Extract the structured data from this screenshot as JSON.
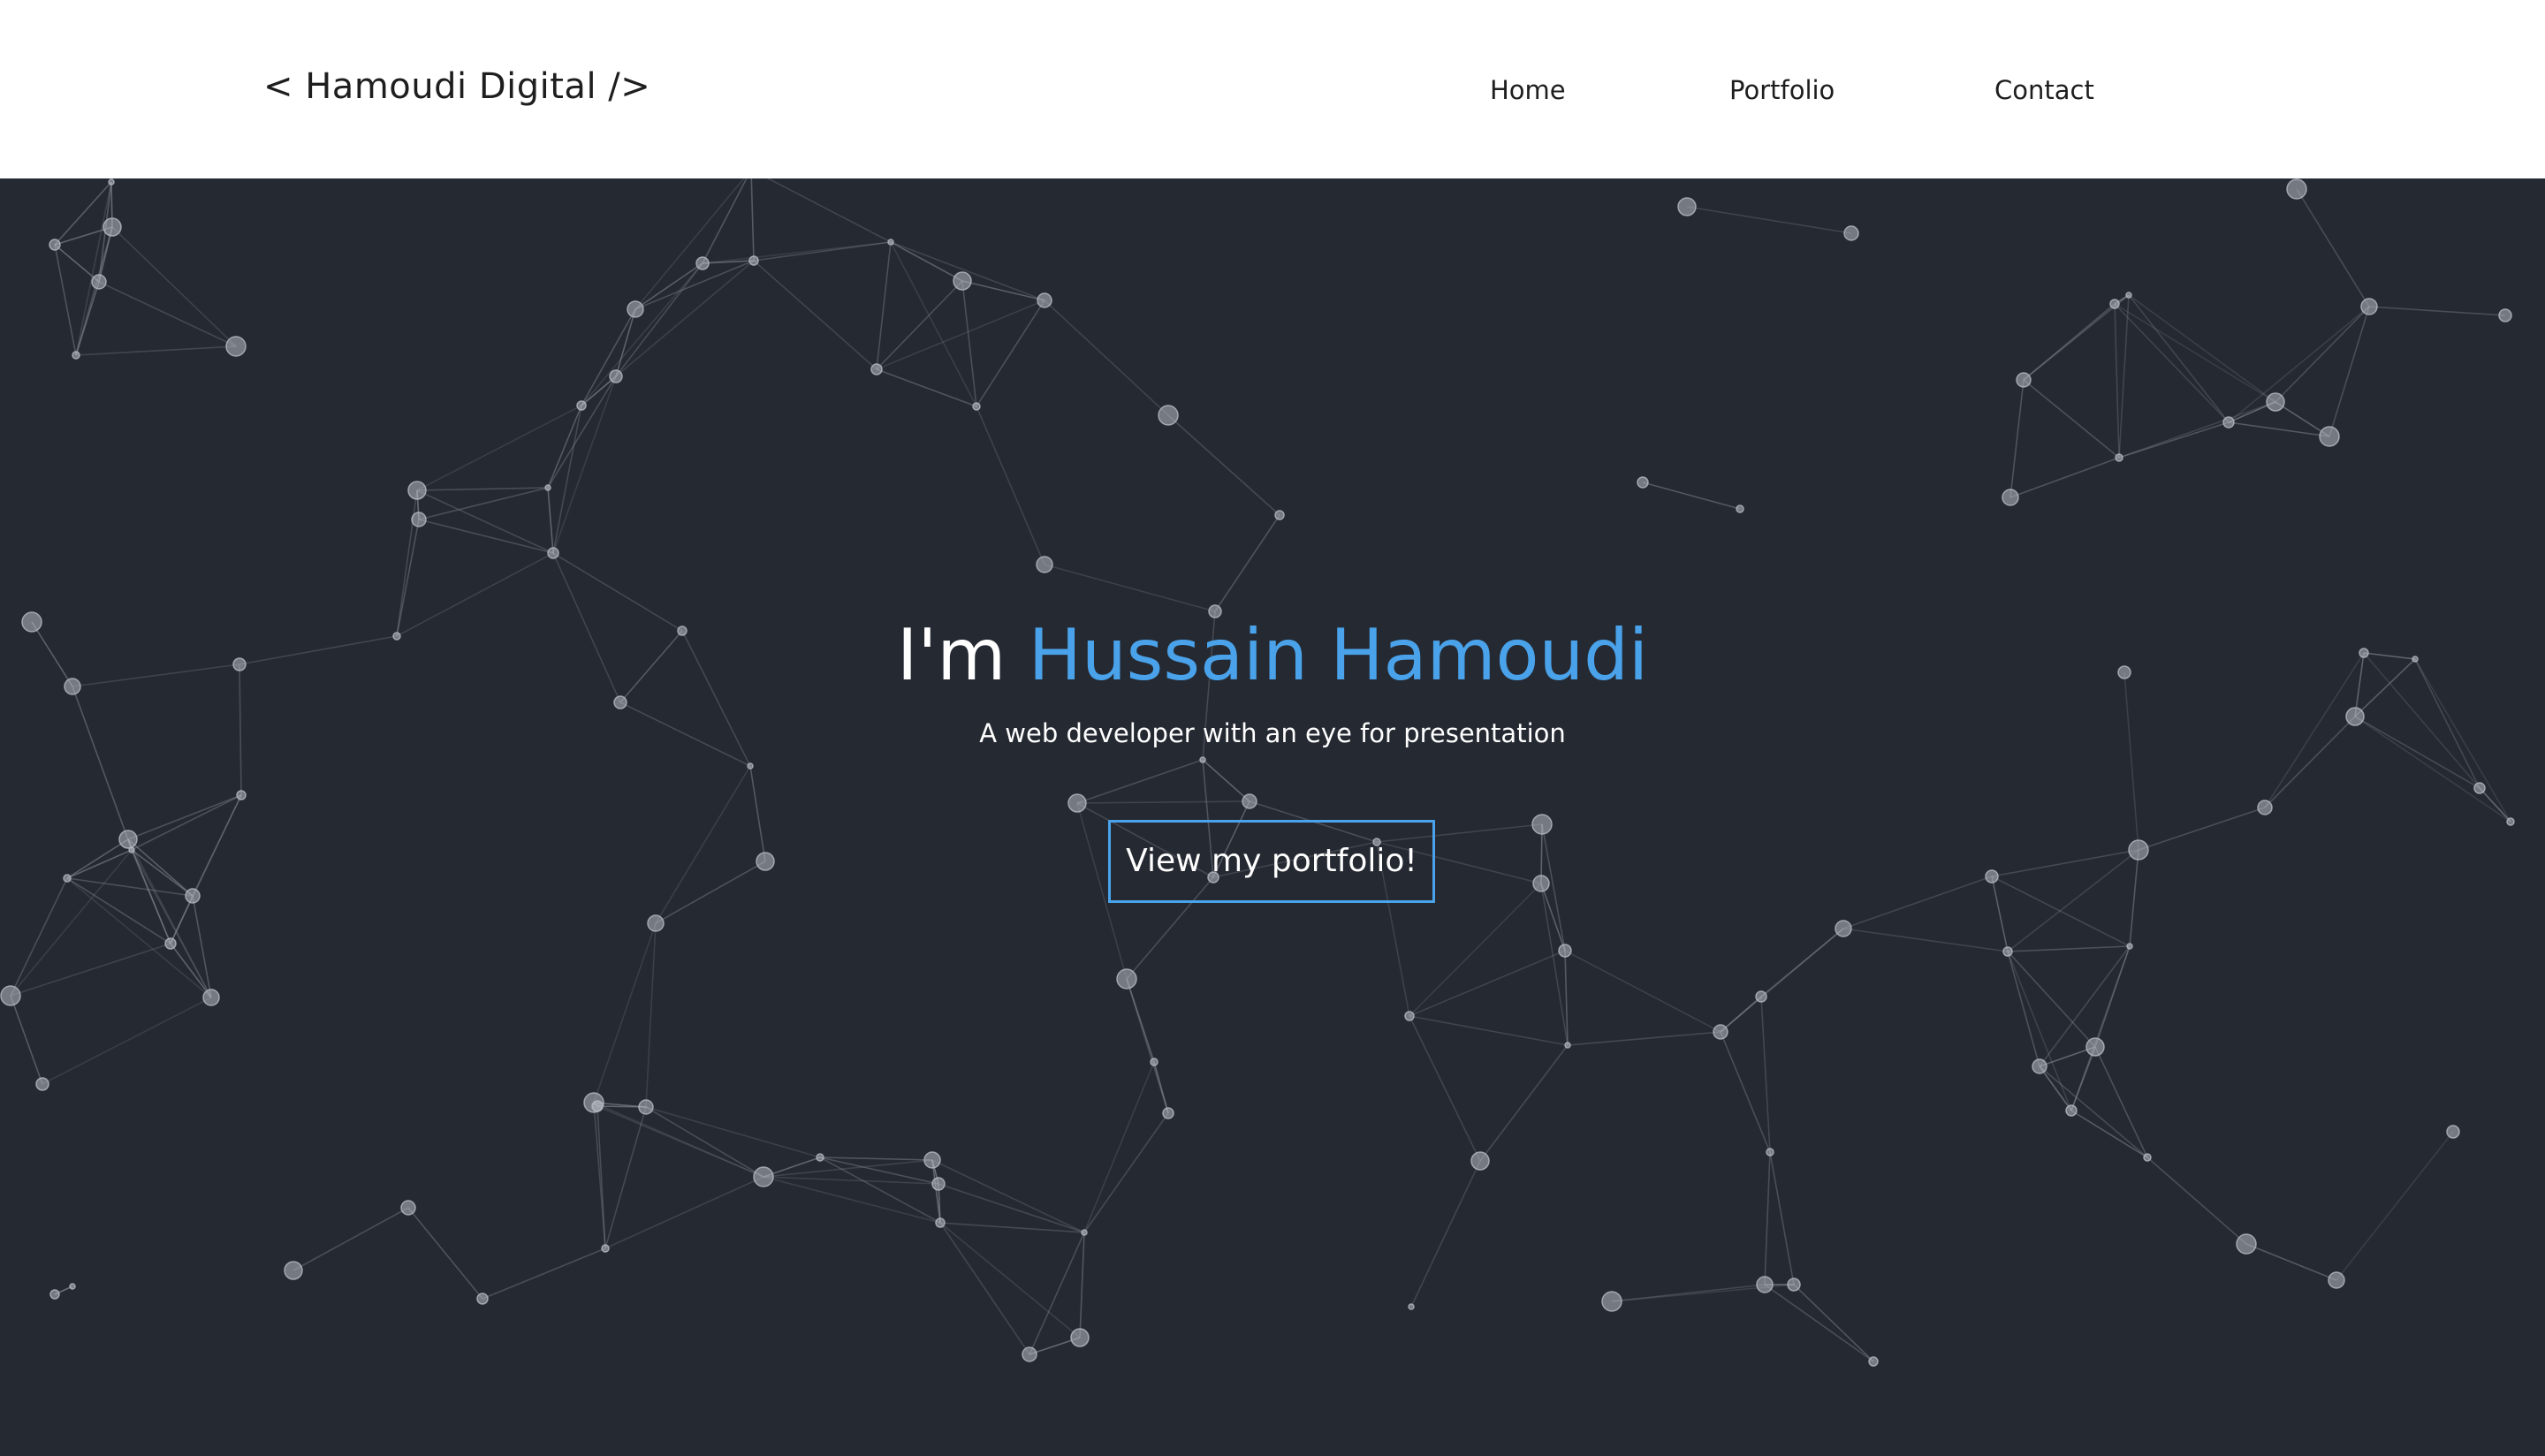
{
  "navbar": {
    "brand": "< Hamoudi Digital />",
    "links": [
      {
        "label": "Home"
      },
      {
        "label": "Portfolio"
      },
      {
        "label": "Contact"
      }
    ]
  },
  "hero": {
    "headline_prefix": "I'm ",
    "headline_name": "Hussain Hamoudi",
    "subtitle": "A web developer with an eye for presentation",
    "cta_label": "View my portfolio!"
  },
  "colors": {
    "background": "#252932",
    "accent": "#4aa3ea",
    "navbar": "#ffffff",
    "network_line": "#8a8f99",
    "network_node": "#b8bcc4"
  },
  "background_effect": {
    "type": "particle-network"
  }
}
